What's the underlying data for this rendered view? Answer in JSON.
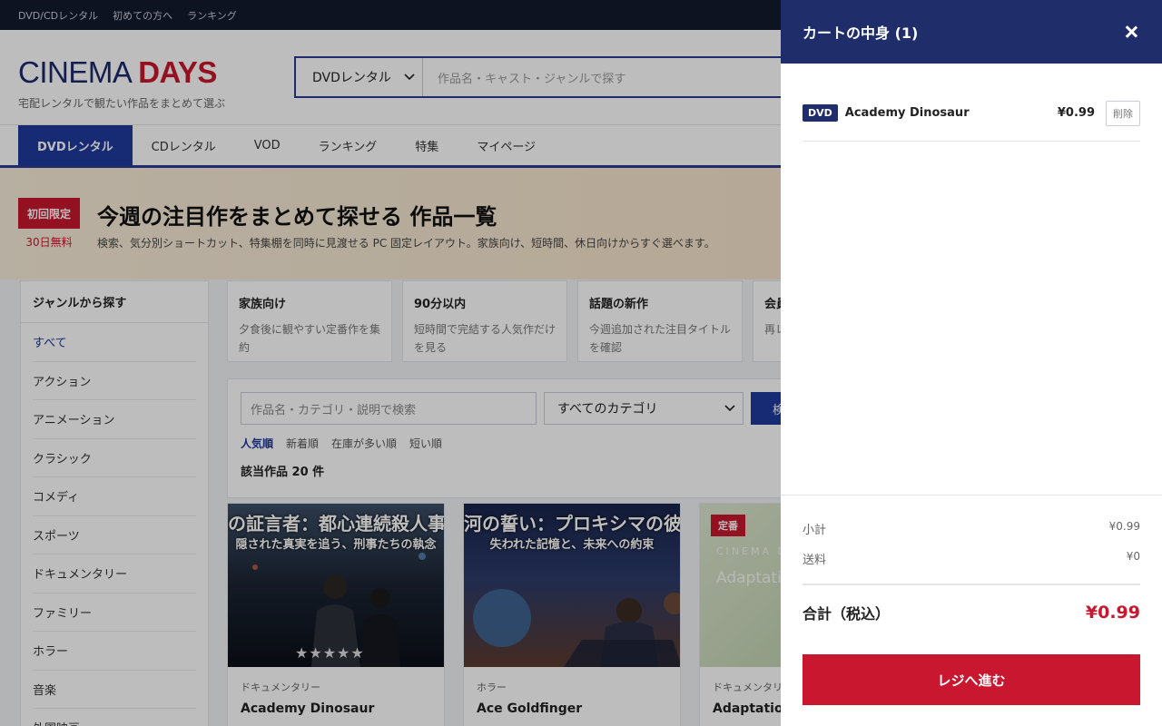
{
  "topbar": {
    "links": [
      "DVD/CDレンタル",
      "初めての方へ",
      "ランキング"
    ]
  },
  "header": {
    "logo_main": "CINEMA",
    "logo_accent": "DAYS",
    "tagline": "宅配レンタルで観たい作品をまとめて選ぶ",
    "search_select": "DVDレンタル",
    "search_placeholder": "作品名・キャスト・ジャンルで探す"
  },
  "nav": {
    "items": [
      "DVDレンタル",
      "CDレンタル",
      "VOD",
      "ランキング",
      "特集",
      "マイページ"
    ]
  },
  "promo": {
    "badge": "初回限定",
    "badge_sub": "30日無料",
    "title": "今週の注目作をまとめて探せる 作品一覧",
    "subtitle": "検索、気分別ショートカット、特集棚を同時に見渡せる PC 固定レイアウト。家族向け、短時間、休日向けからすぐ選べます。"
  },
  "sidebar": {
    "heading": "ジャンルから探す",
    "items": [
      "すべて",
      "アクション",
      "アニメーション",
      "クラシック",
      "コメディ",
      "スポーツ",
      "ドキュメンタリー",
      "ファミリー",
      "ホラー",
      "音楽",
      "外国映画"
    ]
  },
  "shortcuts": [
    {
      "title": "家族向け",
      "desc": "夕食後に観やすい定番作を集約"
    },
    {
      "title": "90分以内",
      "desc": "短時間で完結する人気作だけを見る"
    },
    {
      "title": "話題の新作",
      "desc": "今週追加された注目タイトルを確認"
    },
    {
      "title": "会員",
      "desc": "再レ"
    }
  ],
  "filter": {
    "placeholder": "作品名・カテゴリ・説明で検索",
    "category": "すべてのカテゴリ",
    "button": "検索",
    "sort": [
      "人気順",
      "新着順",
      "在庫が多い順",
      "短い順"
    ],
    "count": "該当作品 20 件"
  },
  "cards": [
    {
      "genre": "ドキュメンタリー",
      "name": "Academy Dinosaur",
      "poster_title": "の証言者：都心連続殺人事",
      "poster_sub": "隠された真実を追う、刑事たちの執念",
      "stars": "★★★★★"
    },
    {
      "genre": "ホラー",
      "name": "Ace Goldfinger",
      "poster_title": "河の誓い：プロキシマの彼方",
      "poster_sub": "失われた記憶と、未来への約束"
    },
    {
      "genre": "ドキュメンタリー",
      "name": "Adaptation Holes",
      "badge": "定番",
      "poster_brand": "CINEMA D",
      "poster_word": "Adaptatio"
    }
  ],
  "cart": {
    "title": "カートの中身 (1)",
    "items": [
      {
        "format": "DVD",
        "name": "Academy Dinosaur",
        "price": "¥0.99",
        "remove": "削除"
      }
    ],
    "subtotal_label": "小計",
    "subtotal": "¥0.99",
    "shipping_label": "送料",
    "shipping": "¥0",
    "total_label": "合計（税込）",
    "total": "¥0.99",
    "checkout": "レジへ進む"
  }
}
